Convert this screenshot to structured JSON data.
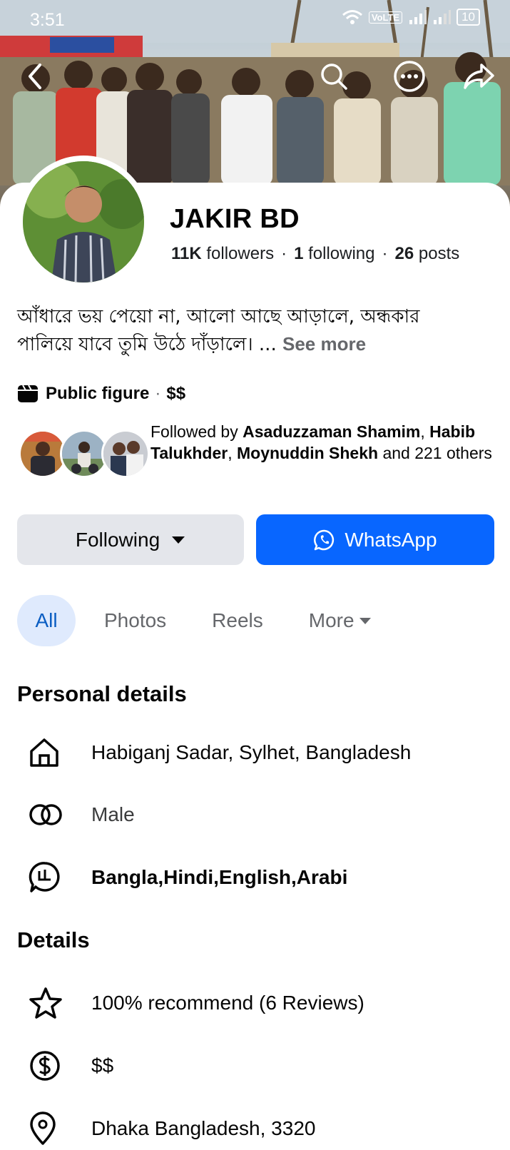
{
  "status_bar": {
    "time": "3:51",
    "network": "VoLTE",
    "battery": "10"
  },
  "profile": {
    "name": "JAKIR BD",
    "followers_count": "11K",
    "followers_label": "followers",
    "following_count": "1",
    "following_label": "following",
    "posts_count": "26",
    "posts_label": "posts",
    "bio": "আঁধারে ভয় পেয়ো না, আলো আছে আড়ালে, অন্ধকার পালিয়ে যাবে তুমি উঠে দাঁড়ালে। ...",
    "see_more": "See more",
    "category": "Public figure",
    "price_range": "$$"
  },
  "followed_by": {
    "prefix": "Followed by",
    "name1": "Asaduzzaman Shamim",
    "name2": "Habib Talukhder",
    "name3": "Moynuddin Shekh",
    "suffix": "and 221 others"
  },
  "actions": {
    "following_label": "Following",
    "whatsapp_label": "WhatsApp"
  },
  "tabs": [
    {
      "label": "All"
    },
    {
      "label": "Photos"
    },
    {
      "label": "Reels"
    },
    {
      "label": "More"
    }
  ],
  "personal_details": {
    "title": "Personal details",
    "items": [
      {
        "icon": "home-icon",
        "text": "Habiganj Sadar, Sylhet, Bangladesh"
      },
      {
        "icon": "gender-icon",
        "text": "Male"
      },
      {
        "icon": "language-icon",
        "text": "Bangla,Hindi,English,Arabi"
      }
    ]
  },
  "details": {
    "title": "Details",
    "items": [
      {
        "icon": "star-icon",
        "text": "100% recommend (6 Reviews)"
      },
      {
        "icon": "dollar-icon",
        "text": "$$"
      },
      {
        "icon": "location-pin-icon",
        "text": "Dhaka Bangladesh, 3320"
      }
    ]
  },
  "colors": {
    "primary_blue": "#0866ff",
    "tab_active_bg": "#dfeafd",
    "secondary_btn_bg": "#e4e6eb"
  }
}
